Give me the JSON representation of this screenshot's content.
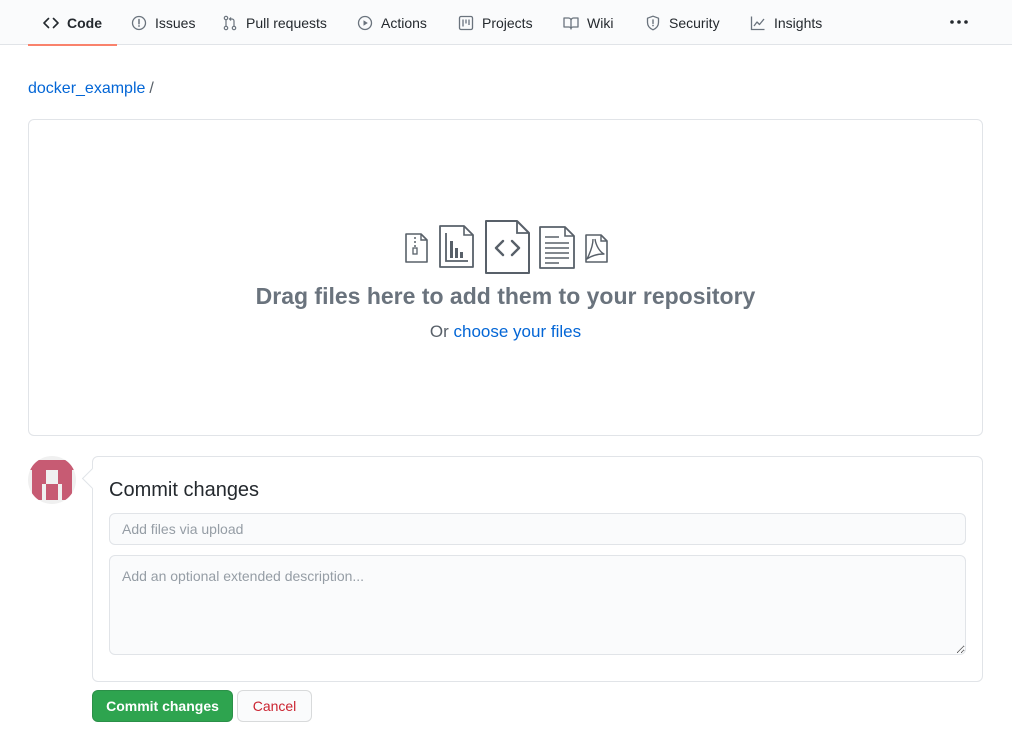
{
  "nav": {
    "tabs": [
      {
        "label": "Code",
        "icon": "code-icon",
        "active": true
      },
      {
        "label": "Issues",
        "icon": "issue-icon"
      },
      {
        "label": "Pull requests",
        "icon": "pull-request-icon"
      },
      {
        "label": "Actions",
        "icon": "play-icon"
      },
      {
        "label": "Projects",
        "icon": "project-icon"
      },
      {
        "label": "Wiki",
        "icon": "book-icon"
      },
      {
        "label": "Security",
        "icon": "shield-icon"
      },
      {
        "label": "Insights",
        "icon": "graph-icon"
      }
    ],
    "more_icon": "kebab-horizontal-icon"
  },
  "breadcrumb": {
    "repo": "docker_example",
    "separator": "/"
  },
  "dropzone": {
    "title": "Drag files here to add them to your repository",
    "sub_prefix": "Or",
    "sub_link": "choose your files",
    "icons": [
      "file-zip-icon",
      "file-chart-icon",
      "file-code-icon",
      "file-text-icon",
      "file-pdf-icon"
    ]
  },
  "commit": {
    "title": "Commit changes",
    "summary_placeholder": "Add files via upload",
    "description_placeholder": "Add an optional extended description...",
    "commit_button": "Commit changes",
    "cancel_button": "Cancel"
  },
  "colors": {
    "link": "#0366d6",
    "active_tab_underline": "#f9826c",
    "commit_button": "#2ea44f",
    "cancel_text": "#cb2431",
    "avatar": "#c75b73"
  }
}
